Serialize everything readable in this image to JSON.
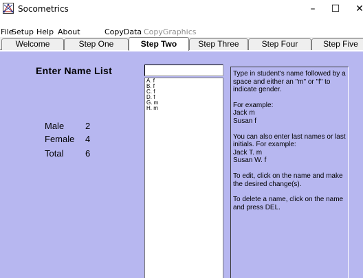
{
  "window": {
    "title": "Socometrics",
    "controls": {
      "minimize": "–",
      "maximize": "☐",
      "close": "✕"
    }
  },
  "menu": [
    "File",
    "Setup",
    "Help",
    "About",
    "CopyData",
    "CopyGraphics"
  ],
  "tabs": [
    {
      "label": "Welcome",
      "active": false
    },
    {
      "label": "Step One",
      "active": false
    },
    {
      "label": "Step Two",
      "active": true
    },
    {
      "label": "Step Three",
      "active": false
    },
    {
      "label": "Step Four",
      "active": false
    },
    {
      "label": "Step Five",
      "active": false
    }
  ],
  "main": {
    "heading": "Enter Name List",
    "stats": [
      {
        "label": "Male",
        "value": "2"
      },
      {
        "label": "Female",
        "value": "4"
      },
      {
        "label": "Total",
        "value": "6"
      }
    ],
    "input_value": "",
    "names": [
      "A. f",
      "B. f",
      "C. f",
      "D. f",
      "G. m",
      "H. m"
    ],
    "help": [
      "Type in student's name followed by a space and either an \"m\" or \"f\" to indicate gender.",
      "For example:\nJack m\nSusan f",
      "You can also enter last names or last initials.  For example:\nJack T. m\nSusan W. f",
      "To edit, click on the name and make the desired change(s).",
      "To delete a name, click on the name and press DEL."
    ]
  },
  "colors": {
    "content_bg": "#b7b7f0",
    "tab_bg": "#efefef",
    "disabled_text": "#8f8f8f"
  }
}
